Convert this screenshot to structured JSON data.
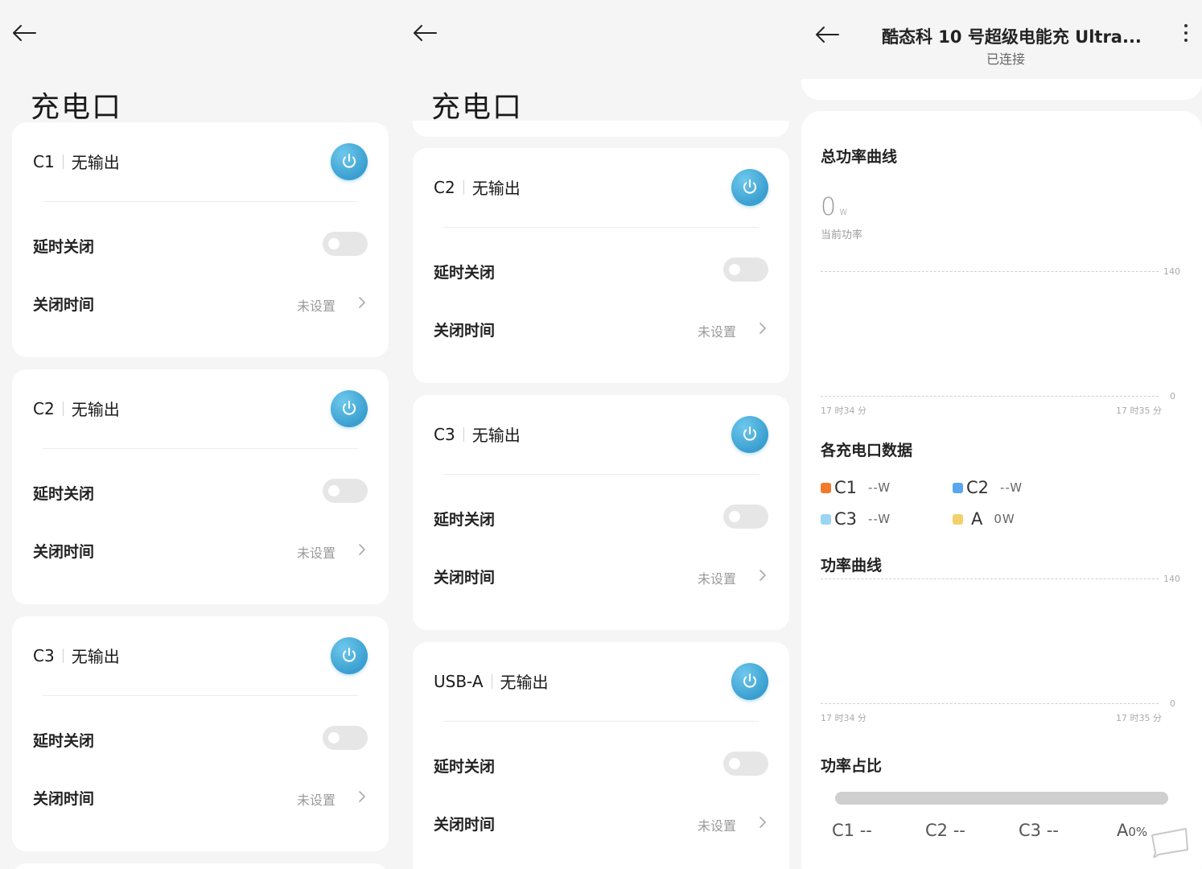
{
  "panel1": {
    "title": "充电口",
    "cards": [
      {
        "port": "C1",
        "status": "无输出",
        "delay_label": "延时关闭",
        "time_label": "关闭时间",
        "time_value": "未设置"
      },
      {
        "port": "C2",
        "status": "无输出",
        "delay_label": "延时关闭",
        "time_label": "关闭时间",
        "time_value": "未设置"
      },
      {
        "port": "C3",
        "status": "无输出",
        "delay_label": "延时关闭",
        "time_label": "关闭时间",
        "time_value": "未设置"
      }
    ]
  },
  "panel2": {
    "title": "充电口",
    "cards": [
      {
        "port": "C2",
        "status": "无输出",
        "delay_label": "延时关闭",
        "time_label": "关闭时间",
        "time_value": "未设置"
      },
      {
        "port": "C3",
        "status": "无输出",
        "delay_label": "延时关闭",
        "time_label": "关闭时间",
        "time_value": "未设置"
      },
      {
        "port": "USB-A",
        "status": "无输出",
        "delay_label": "延时关闭",
        "time_label": "关闭时间",
        "time_value": "未设置"
      }
    ]
  },
  "panel3": {
    "device_name": "酷态科 10 号超级电能充 Ultra...",
    "connection_status": "已连接",
    "total_power": {
      "title": "总功率曲线",
      "current_value": "0",
      "current_unit": "w",
      "current_label": "当前功率",
      "y_max": "140",
      "y_min": "0",
      "x_start": "17 时34 分",
      "x_end": "17 时35 分"
    },
    "ports_data": {
      "title": "各充电口数据",
      "items": [
        {
          "name": "C1",
          "value": "--W",
          "color": "#f07b2d"
        },
        {
          "name": "C2",
          "value": "--W",
          "color": "#5aa6ef"
        },
        {
          "name": "C3",
          "value": "--W",
          "color": "#9ad6f2"
        },
        {
          "name": "A",
          "value": "0W",
          "color": "#f4d06a"
        }
      ]
    },
    "power_curve": {
      "title": "功率曲线",
      "y_max": "140",
      "y_min": "0",
      "x_start": "17 时34 分",
      "x_end": "17 时35 分"
    },
    "power_ratio": {
      "title": "功率占比",
      "labels": [
        {
          "name": "C1",
          "value": "--"
        },
        {
          "name": "C2",
          "value": "--"
        },
        {
          "name": "C3",
          "value": "--"
        },
        {
          "name": "A",
          "value": "0%"
        }
      ]
    }
  }
}
